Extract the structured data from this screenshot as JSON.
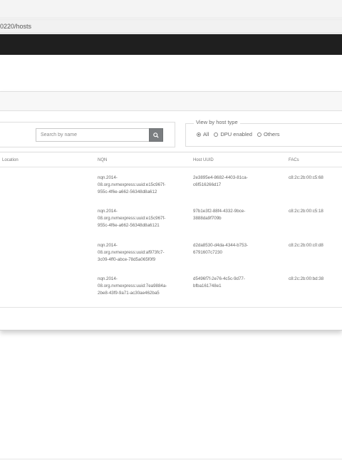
{
  "browser": {
    "url_text": "0220/hosts"
  },
  "toolbar": {
    "search_placeholder": "Search by name",
    "filter_legend": "View by host type",
    "filter_options": [
      {
        "label": "All",
        "selected": true
      },
      {
        "label": "DPU enabled",
        "selected": false
      },
      {
        "label": "Others",
        "selected": false
      }
    ]
  },
  "table": {
    "headers": {
      "location": "Location",
      "nqn": "NQN",
      "host_uuid": "Host UUID",
      "facs": "FACs"
    },
    "rows": [
      {
        "nqn": [
          "nqn.2014-",
          "08.org.nvmexpress:uuid:e15c967f-",
          "955c-4f6e-a662-56348d8a612"
        ],
        "uuid": [
          "2e3895e4-8682-4403-81ca-",
          "c6f516266d17"
        ],
        "fac": "c8:2c:2b:00:c5:68"
      },
      {
        "nqn": [
          "nqn.2014-",
          "08.org.nvmexpress:uuid:e15c967f-",
          "955c-4f6e-a662-56348d8a6121"
        ],
        "uuid": [
          "97b1e3f2-88f4-4332-9bce-",
          "3888da9f709b"
        ],
        "fac": "c8:2c:2b:00:c5:18"
      },
      {
        "nqn": [
          "nqn.2014-",
          "08.org.nvmexpress:uuid:af973fc7-",
          "3c09-4ff0-abce-78d5a065f0f9"
        ],
        "uuid": [
          "d2da8530-d4da-4344-b753-",
          "6791607c7230"
        ],
        "fac": "c8:2c:2b:00:c0:d8"
      },
      {
        "nqn": [
          "nqn.2014-",
          "08.org.nvmexpress:uuid:7ea9884a-",
          "2be8-43f9-9a71-ac30ae462ba5"
        ],
        "uuid": [
          "d5496f7f-2e76-4c5c-9d77-",
          "bfba161748e1"
        ],
        "fac": "c8:2c:2b:00:bd:38"
      }
    ]
  },
  "icons": {
    "search": "search-icon"
  }
}
